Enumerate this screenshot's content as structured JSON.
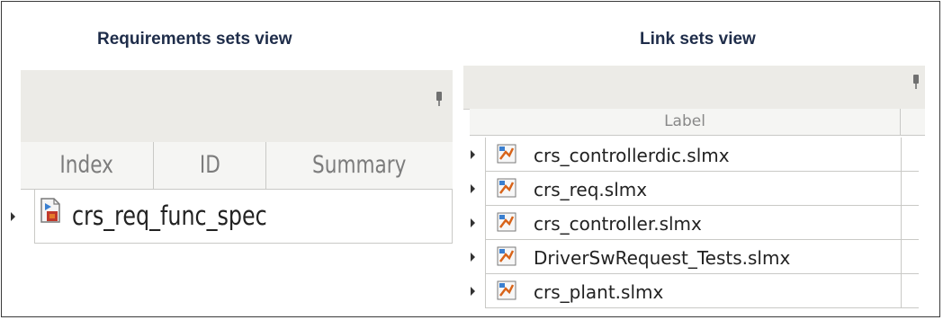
{
  "captions": {
    "left": "Requirements sets view",
    "right": "Link sets view"
  },
  "requirements_view": {
    "columns": [
      "Index",
      "ID",
      "Summary"
    ],
    "rows": [
      {
        "label": "crs_req_func_spec",
        "icon": "requirement-set-file-icon"
      }
    ]
  },
  "link_view": {
    "column": "Label",
    "rows": [
      {
        "label": "crs_controllerdic.slmx",
        "icon": "link-set-file-icon"
      },
      {
        "label": "crs_req.slmx",
        "icon": "link-set-file-icon"
      },
      {
        "label": "crs_controller.slmx",
        "icon": "link-set-file-icon"
      },
      {
        "label": "DriverSwRequest_Tests.slmx",
        "icon": "link-set-file-icon"
      },
      {
        "label": "crs_plant.slmx",
        "icon": "link-set-file-icon"
      }
    ]
  }
}
